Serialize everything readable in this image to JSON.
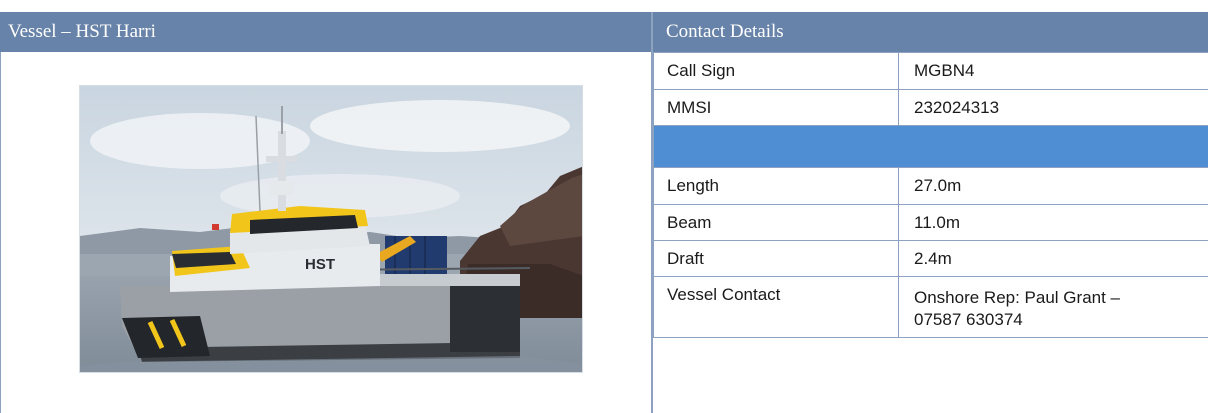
{
  "vessel_panel": {
    "title": "Vessel – HST Harri",
    "photo": {
      "hull_text": "HST",
      "colors": {
        "accent": "#f2c51b",
        "hull": "#9aa0a6",
        "sky": "#dde5ec",
        "sea": "#8f9aa6",
        "rock": "#4a3530"
      }
    }
  },
  "contact_panel": {
    "title": "Contact Details",
    "rows": [
      {
        "label": "Call Sign",
        "value": "MGBN4"
      },
      {
        "label": "MMSI",
        "value": "232024313"
      },
      {
        "label": "",
        "value": ""
      },
      {
        "label": "Length",
        "value": "27.0m"
      },
      {
        "label": "Beam",
        "value": "11.0m"
      },
      {
        "label": "Draft",
        "value": "2.4m"
      },
      {
        "label": "Vessel Contact",
        "value_line1": "Onshore Rep: Paul Grant –",
        "value_line2": "07587 630374"
      }
    ]
  },
  "colors": {
    "header_bg": "#6783a9",
    "band_bg": "#4f8ed3",
    "border": "#8da2c0"
  }
}
